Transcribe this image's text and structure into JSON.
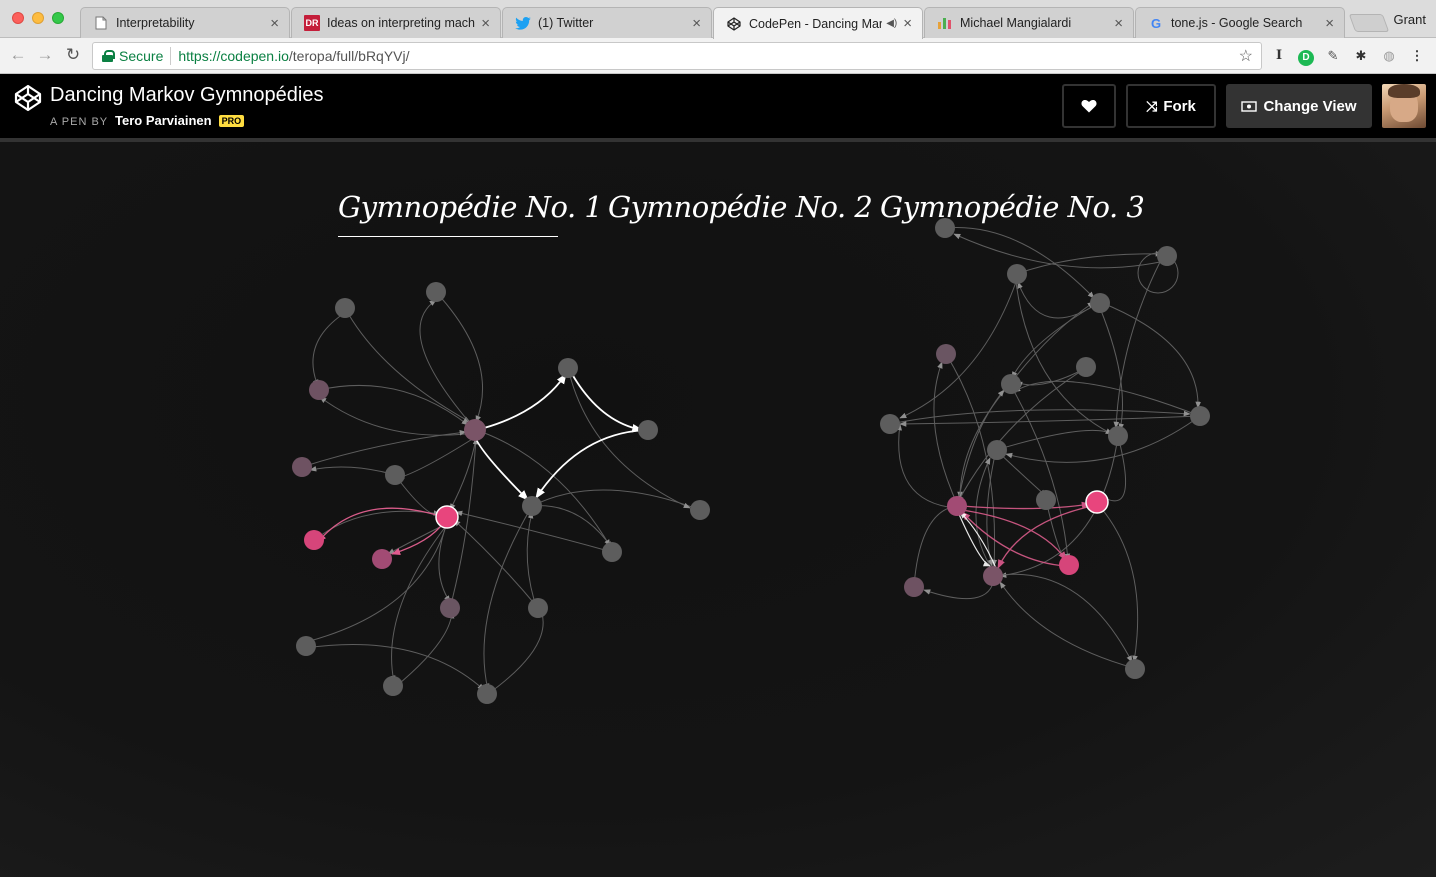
{
  "browser": {
    "profile_name": "Grant",
    "tabs": [
      {
        "title": "Interpretability",
        "favicon": "page-icon"
      },
      {
        "title": "Ideas on interpreting machi",
        "favicon": "dr-icon"
      },
      {
        "title": "(1) Twitter",
        "favicon": "twitter-icon"
      },
      {
        "title": "CodePen - Dancing Mar",
        "favicon": "codepen-icon",
        "active": true,
        "audio": true
      },
      {
        "title": "Michael Mangialardi",
        "favicon": "chart-icon"
      },
      {
        "title": "tone.js - Google Search",
        "favicon": "google-icon"
      }
    ],
    "address": {
      "secure_label": "Secure",
      "host": "https://codepen.io",
      "path": "/teropa/full/bRqYVj/"
    }
  },
  "codepen": {
    "pen_title": "Dancing Markov Gymnopédies",
    "by_label": "A PEN BY",
    "author": "Tero Parviainen",
    "badge": "PRO",
    "fork_label": "Fork",
    "change_view_label": "Change View"
  },
  "pieces": [
    {
      "label": "Gymnopédie No. 1",
      "active": true
    },
    {
      "label": "Gymnopédie No. 2",
      "active": false
    },
    {
      "label": "Gymnopédie No. 3",
      "active": false
    }
  ],
  "colors": {
    "node_gray": "#5a5a5a",
    "node_mauve": "#7a5467",
    "node_rose": "#a24b74",
    "node_pink": "#e8457d",
    "edge": "#8a8a8a",
    "edge_hot": "#ffffff",
    "edge_pink": "#d95c8a"
  }
}
